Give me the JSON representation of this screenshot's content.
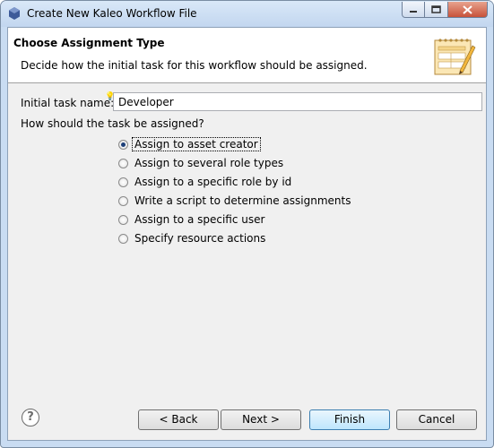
{
  "window": {
    "title": "Create New Kaleo Workflow File"
  },
  "banner": {
    "title": "Choose Assignment Type",
    "description": "Decide how the initial task for this workflow should be assigned."
  },
  "form": {
    "task_name_label": "Initial task name:",
    "task_name_value": "Developer",
    "question": "How should the task be assigned?",
    "options": [
      {
        "label": "Assign to asset creator",
        "selected": true
      },
      {
        "label": "Assign to several role types",
        "selected": false
      },
      {
        "label": "Assign to a specific role by id",
        "selected": false
      },
      {
        "label": "Write a script to determine assignments",
        "selected": false
      },
      {
        "label": "Assign to a specific user",
        "selected": false
      },
      {
        "label": "Specify resource actions",
        "selected": false
      }
    ]
  },
  "footer": {
    "help_label": "?",
    "back_label": "< Back",
    "next_label": "Next >",
    "finish_label": "Finish",
    "cancel_label": "Cancel"
  },
  "colors": {
    "accent": "#3c7fb1",
    "titlebar": "#c9dcf2",
    "close": "#c7523a"
  },
  "icons": [
    "kaleo-icon",
    "minimize-icon",
    "maximize-icon",
    "close-icon",
    "workflow-wizard-icon",
    "help-icon"
  ]
}
